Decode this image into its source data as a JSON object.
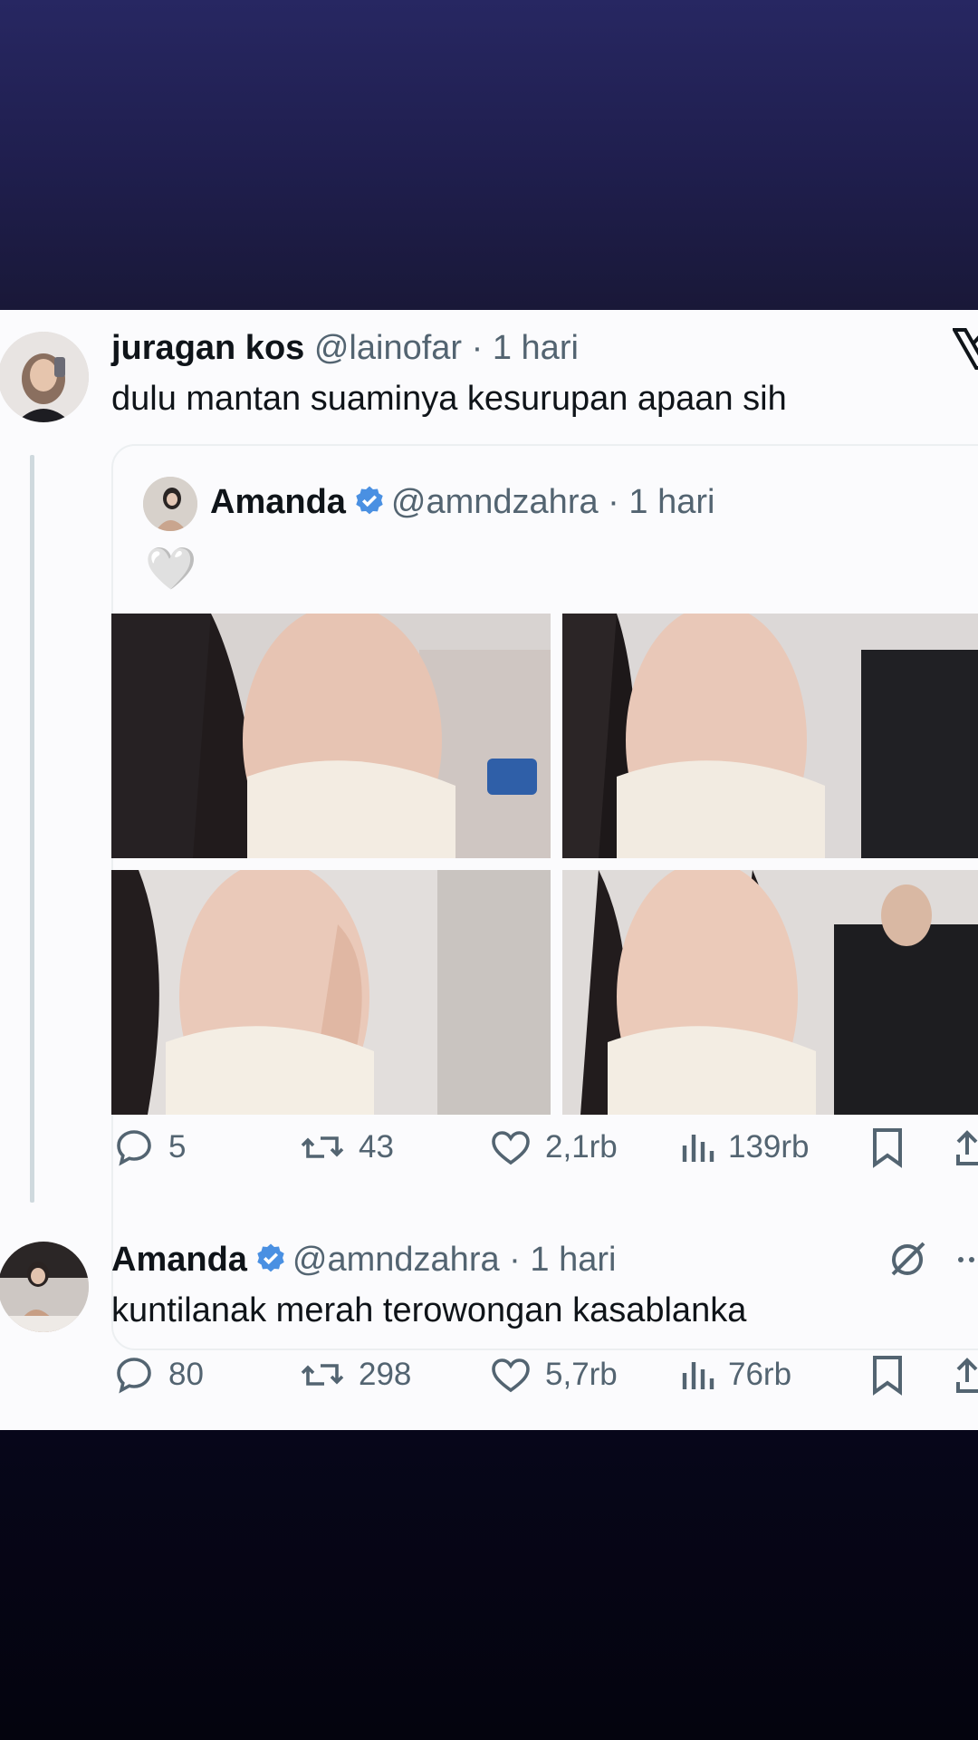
{
  "reply_tweet": {
    "display_name": "juragan kos",
    "handle": "@lainofar",
    "separator": "·",
    "time": "1 hari",
    "text": "dulu mantan suaminya kesurupan apaan sih",
    "quoted": {
      "display_name": "Amanda",
      "handle": "@amndzahra",
      "separator": "·",
      "time": "1 hari",
      "emoji": "🤍",
      "photos": [
        "photo-1",
        "photo-2",
        "photo-3",
        "photo-4"
      ]
    },
    "stats": {
      "replies": "5",
      "reposts": "43",
      "likes": "2,1rb",
      "views": "139rb"
    }
  },
  "main_tweet": {
    "display_name": "Amanda",
    "handle": "@amndzahra",
    "separator": "·",
    "time": "1 hari",
    "text": "kuntilanak merah terowongan kasablanka",
    "stats": {
      "replies": "80",
      "reposts": "298",
      "likes": "5,7rb",
      "views": "76rb"
    }
  },
  "icons": {
    "reply": "reply-icon",
    "repost": "repost-icon",
    "like": "heart-icon",
    "views": "views-icon",
    "bookmark": "bookmark-icon",
    "share": "share-icon",
    "logo": "x-logo-icon",
    "verified": "verified-badge-icon",
    "grok": "grok-icon",
    "more": "more-icon"
  },
  "colors": {
    "verified": "#4a90e2",
    "muted_text": "#536471",
    "card_bg": "#fbfbfd"
  }
}
